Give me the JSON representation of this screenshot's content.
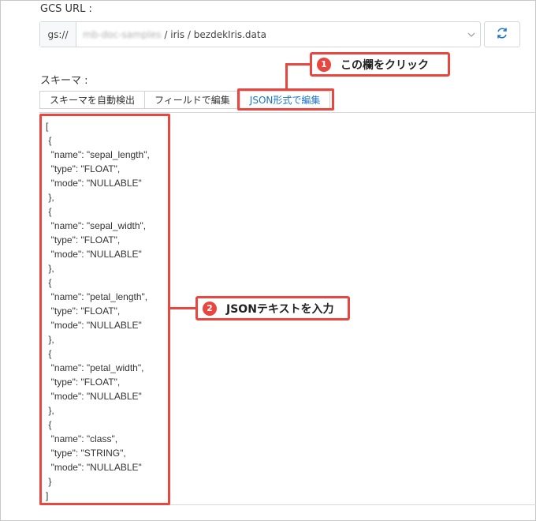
{
  "gcs": {
    "label": "GCS URL :",
    "prefix": "gs://",
    "bucket_blurred": "mb-doc-samples",
    "path": "/ iris / bezdekIris.data"
  },
  "schema": {
    "label": "スキーマ :",
    "tabs": [
      {
        "label": "スキーマを自動検出",
        "active": false
      },
      {
        "label": "フィールドで編集",
        "active": false
      },
      {
        "label": "JSON形式で編集",
        "active": true
      }
    ],
    "json_text": "[\n {\n  \"name\": \"sepal_length\",\n  \"type\": \"FLOAT\",\n  \"mode\": \"NULLABLE\"\n },\n {\n  \"name\": \"sepal_width\",\n  \"type\": \"FLOAT\",\n  \"mode\": \"NULLABLE\"\n },\n {\n  \"name\": \"petal_length\",\n  \"type\": \"FLOAT\",\n  \"mode\": \"NULLABLE\"\n },\n {\n  \"name\": \"petal_width\",\n  \"type\": \"FLOAT\",\n  \"mode\": \"NULLABLE\"\n },\n {\n  \"name\": \"class\",\n  \"type\": \"STRING\",\n  \"mode\": \"NULLABLE\"\n }\n]"
  },
  "annotations": {
    "step1": {
      "number": "1",
      "text": "この欄をクリック"
    },
    "step2": {
      "number": "2",
      "text": "JSONテキストを入力"
    },
    "color": "#e8463f"
  },
  "icons": {
    "dropdown": "chevron-down-icon",
    "refresh": "refresh-icon"
  },
  "colors": {
    "accent": "#1a73c6",
    "annotation": "#e8463f"
  }
}
